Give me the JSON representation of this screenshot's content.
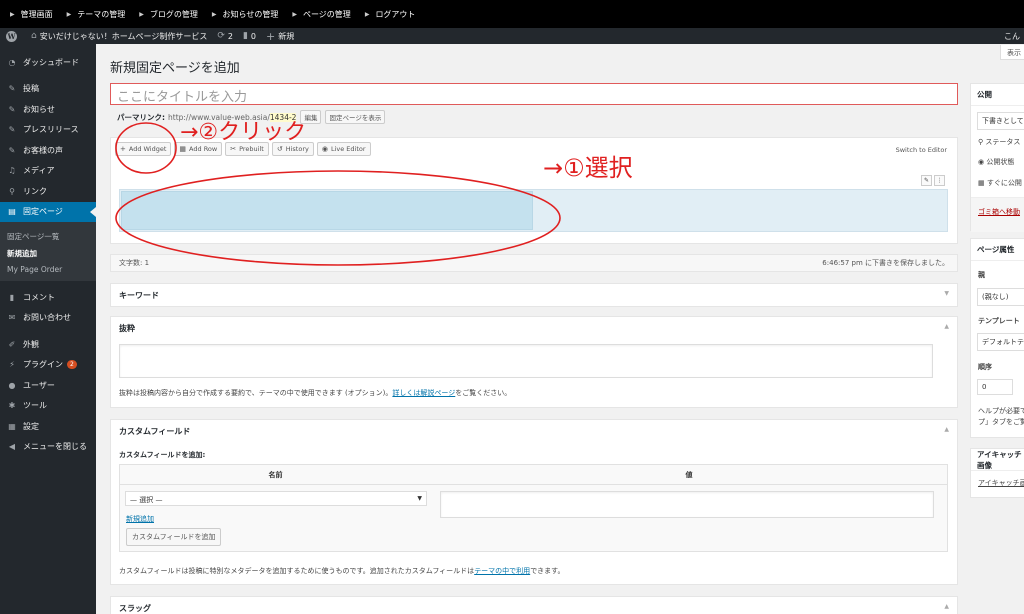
{
  "topbar": {
    "items": [
      "管理画面",
      "テーマの管理",
      "ブログの管理",
      "お知らせの管理",
      "ページの管理",
      "ログアウト"
    ]
  },
  "adminbar": {
    "site_name": "安いだけじゃない！ホームページ制作サービス",
    "updates_count": "2",
    "comments_count": "0",
    "new_label": "新規",
    "howdy": "こん"
  },
  "sidebar": {
    "items": [
      {
        "label": "ダッシュボード",
        "icon": "dashboard-icon"
      },
      {
        "label": "投稿",
        "icon": "pin-icon"
      },
      {
        "label": "お知らせ",
        "icon": "pin-icon"
      },
      {
        "label": "プレスリリース",
        "icon": "pin-icon"
      },
      {
        "label": "お客様の声",
        "icon": "pin-icon"
      },
      {
        "label": "メディア",
        "icon": "media-icon"
      },
      {
        "label": "リンク",
        "icon": "link-icon"
      },
      {
        "label": "固定ページ",
        "icon": "page-icon"
      }
    ],
    "submenu": [
      "固定ページ一覧",
      "新規追加",
      "My Page Order"
    ],
    "items2": [
      {
        "label": "コメント",
        "icon": "comment-icon"
      },
      {
        "label": "お問い合わせ",
        "icon": "mail-icon"
      }
    ],
    "items3": [
      {
        "label": "外観",
        "icon": "brush-icon"
      },
      {
        "label": "プラグイン",
        "icon": "plugin-icon"
      },
      {
        "label": "ユーザー",
        "icon": "user-icon"
      },
      {
        "label": "ツール",
        "icon": "wrench-icon"
      },
      {
        "label": "設定",
        "icon": "settings-icon"
      },
      {
        "label": "メニューを閉じる",
        "icon": "collapse-icon"
      }
    ],
    "plugin_badge": "2"
  },
  "screen_options": "表示",
  "page_title": "新規固定ページを追加",
  "title_placeholder": "ここにタイトルを入力",
  "permalink": {
    "label": "パーマリンク:",
    "url": "http://www.value-web.asia/",
    "slug": "1434-2",
    "edit_btn": "編集",
    "view_btn": "固定ページを表示"
  },
  "editor": {
    "buttons": [
      "Add Widget",
      "Add Row",
      "Prebuilt",
      "History",
      "Live Editor"
    ],
    "switch_label": "Switch to Editor",
    "row_tool_1": "✎",
    "row_tool_2": "⋮"
  },
  "status": {
    "word_count": "文字数: 1",
    "saved": "6:46:57 pm に下書きを保存しました。"
  },
  "keyword_box": {
    "title": "キーワード"
  },
  "excerpt_box": {
    "title": "抜粋",
    "help_before": "抜粋は投稿内容から自分で作成する要約で、テーマの中で使用できます (オプション)。",
    "help_link": "詳しくは解説ページ",
    "help_after": "をご覧ください。"
  },
  "custom_fields": {
    "title": "カスタムフィールド",
    "add_label": "カスタムフィールドを追加:",
    "col_name": "名前",
    "col_value": "値",
    "select_value": "— 選択 —",
    "new_link": "新規追加",
    "add_button": "カスタムフィールドを追加",
    "help_before": "カスタムフィールドは投稿に特別なメタデータを追加するために使うものです。追加されたカスタムフィールドは",
    "help_link": "テーマの中で利用",
    "help_after": "できます。"
  },
  "slug_box": {
    "title": "スラッグ"
  },
  "publish_box": {
    "title": "公開",
    "save_draft": "下書きとして保存",
    "status_label": "ステータス",
    "visibility_label": "公開状態",
    "schedule_label": "すぐに公開",
    "trash_link": "ゴミ箱へ移動"
  },
  "attributes_box": {
    "title": "ページ属性",
    "parent_label": "親",
    "parent_value": "(親なし)",
    "template_label": "テンプレート",
    "template_value": "デフォルトテンプレート",
    "order_label": "順序",
    "order_value": "0",
    "help_text_1": "ヘルプが必要ですか？",
    "help_text_2": "プ」タブをご覧ください。"
  },
  "featured_box": {
    "title": "アイキャッチ画像",
    "link": "アイキャッチ画像を設定"
  },
  "annotations": {
    "click": "→②クリック",
    "select": "→①選択"
  },
  "colors": {
    "annotation_red": "#e02020",
    "accent_blue": "#0073aa",
    "sidebar_bg": "#23282d"
  }
}
